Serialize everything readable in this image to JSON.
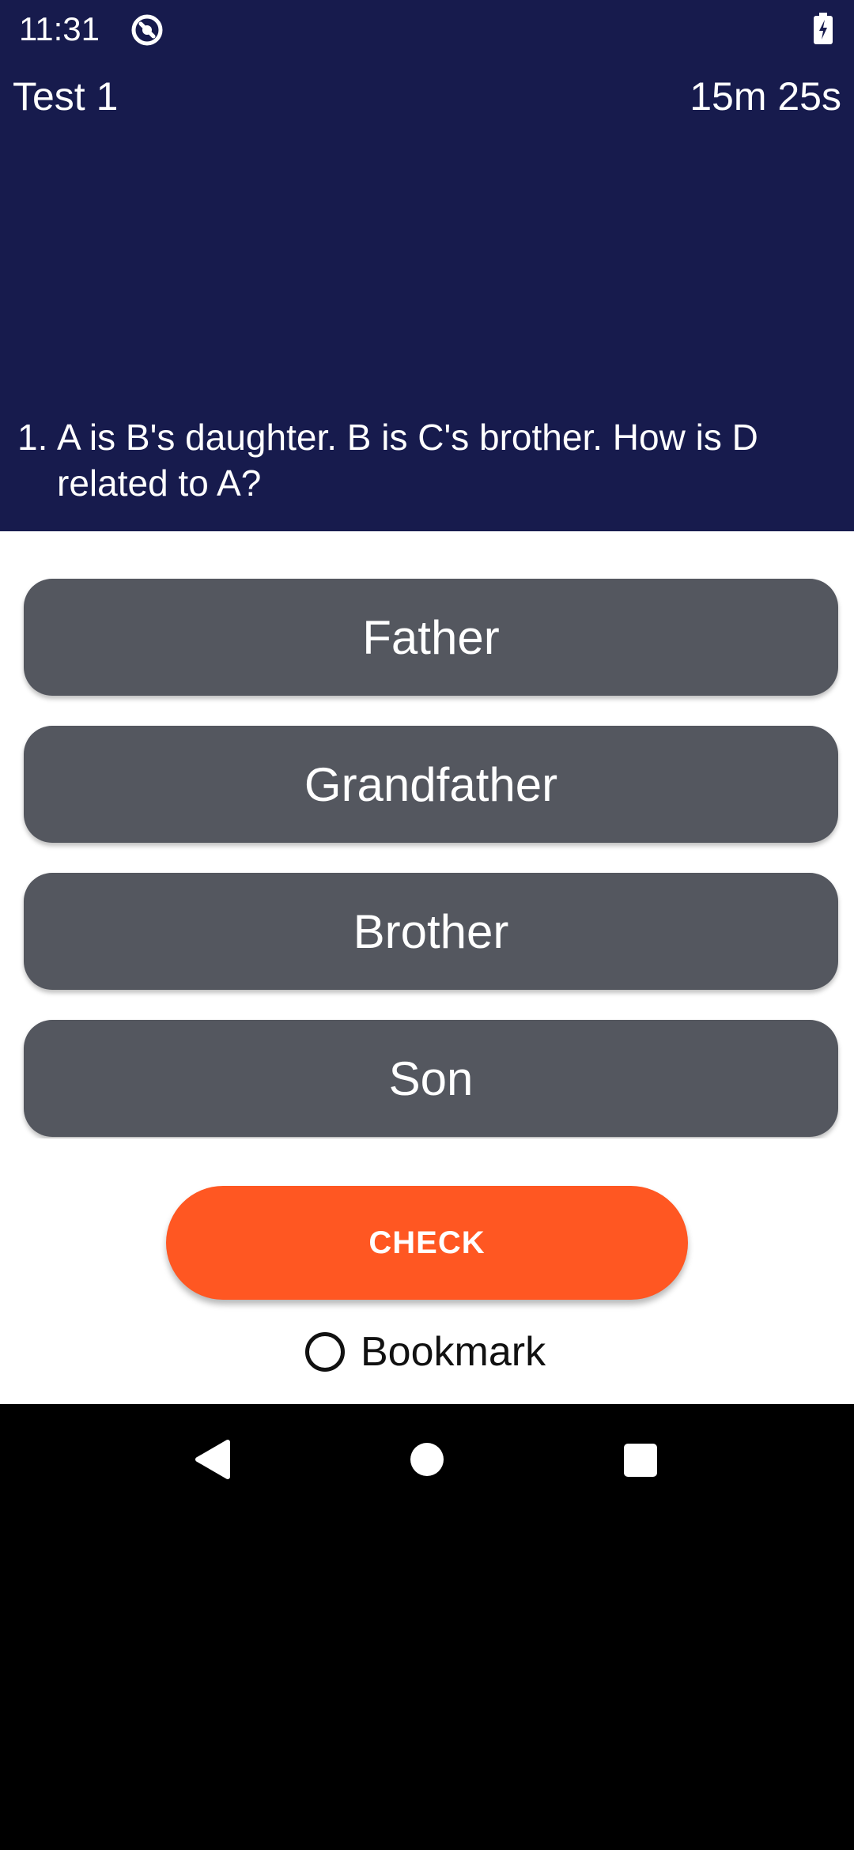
{
  "status_bar": {
    "time": "11:31",
    "icons": [
      "app-notification-icon",
      "battery-charging-icon"
    ]
  },
  "header": {
    "title": "Test 1",
    "timer": "15m 25s"
  },
  "question": {
    "number": "1.",
    "text": "A is B's daughter. B is C's brother. How is D related to A?"
  },
  "options": [
    {
      "label": "Father"
    },
    {
      "label": "Grandfather"
    },
    {
      "label": "Brother"
    },
    {
      "label": "Son"
    }
  ],
  "actions": {
    "check_label": "CHECK",
    "bookmark_label": "Bookmark",
    "bookmark_checked": false
  },
  "nav_bar": {
    "buttons": [
      "back-icon",
      "home-icon",
      "recents-icon"
    ]
  },
  "colors": {
    "header_bg": "#171b4d",
    "option_bg": "#54575f",
    "check_bg": "#ff5722"
  }
}
